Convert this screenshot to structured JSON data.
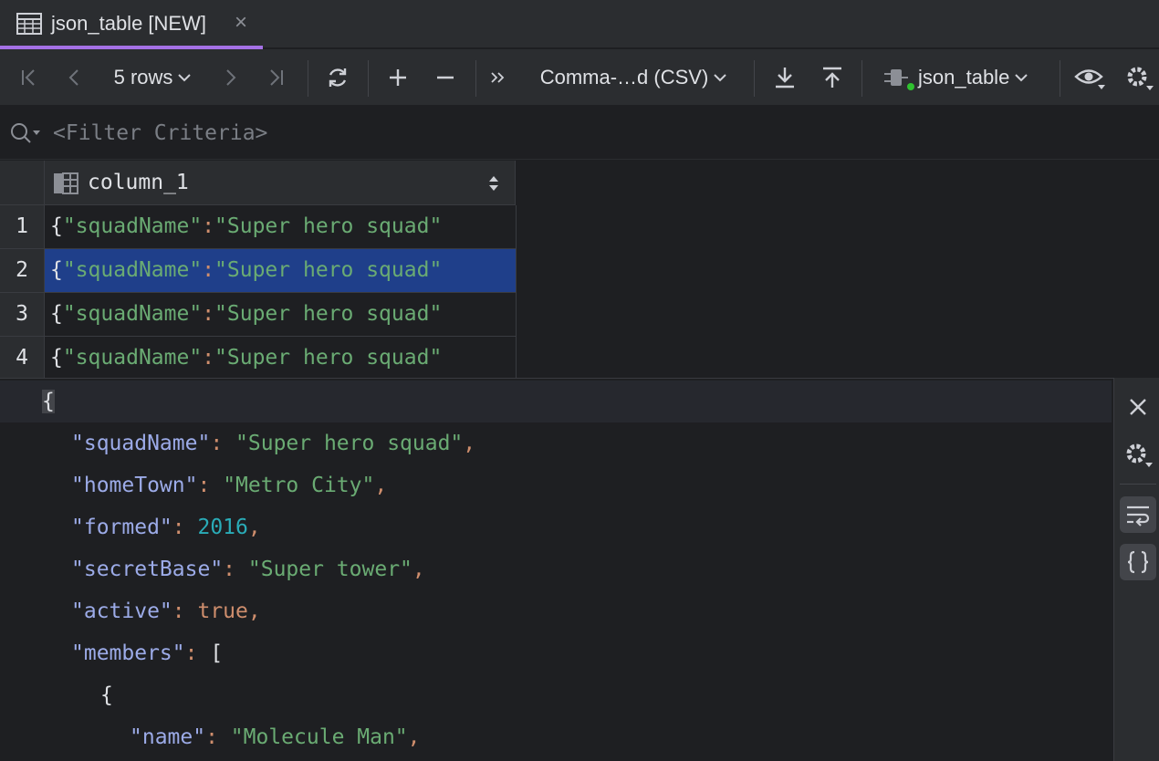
{
  "tab": {
    "title": "json_table [NEW]",
    "icon": "table-icon",
    "close": "×"
  },
  "toolbar": {
    "rows_label": "5 rows",
    "format_label": "Comma-…d (CSV)",
    "datasource_label": "json_table",
    "icons": [
      "first-page-icon",
      "prev-page-icon",
      "next-page-icon",
      "last-page-icon",
      "refresh-icon",
      "add-row-icon",
      "delete-row-icon",
      "more-icon",
      "download-icon",
      "upload-icon",
      "datasource-icon",
      "view-icon",
      "settings-icon"
    ]
  },
  "filter": {
    "placeholder": "<Filter Criteria>"
  },
  "grid": {
    "column": "column_1",
    "rows": [
      {
        "num": "1",
        "brace": "{",
        "key": "\"squadName\"",
        "colon": ":",
        "value": "\"Super hero squad\""
      },
      {
        "num": "2",
        "brace": "{",
        "key": "\"squadName\"",
        "colon": ":",
        "value": "\"Super hero squad\""
      },
      {
        "num": "3",
        "brace": "{",
        "key": "\"squadName\"",
        "colon": ":",
        "value": "\"Super hero squad\""
      },
      {
        "num": "4",
        "brace": "{",
        "key": "\"squadName\"",
        "colon": ":",
        "value": "\"Super hero squad\""
      }
    ],
    "selected_row": "2"
  },
  "editor": {
    "open_brace": "{",
    "lines": [
      {
        "key": "\"squadName\"",
        "sep": ": ",
        "value": "\"Super hero squad\"",
        "value_type": "string",
        "end": ","
      },
      {
        "key": "\"homeTown\"",
        "sep": ": ",
        "value": "\"Metro City\"",
        "value_type": "string",
        "end": ","
      },
      {
        "key": "\"formed\"",
        "sep": ": ",
        "value": "2016",
        "value_type": "number",
        "end": ","
      },
      {
        "key": "\"secretBase\"",
        "sep": ": ",
        "value": "\"Super tower\"",
        "value_type": "string",
        "end": ","
      },
      {
        "key": "\"active\"",
        "sep": ": ",
        "value": "true",
        "value_type": "boolean",
        "end": ","
      },
      {
        "key": "\"members\"",
        "sep": ": ",
        "value": "[",
        "value_type": "bracket",
        "end": ""
      }
    ],
    "member_open": "{",
    "member_line": {
      "key": "\"name\"",
      "sep": ": ",
      "value": "\"Molecule Man\"",
      "end": ","
    }
  },
  "colors": {
    "accent": "#a571e6",
    "selection": "#1f3f8a",
    "string": "#6aab73",
    "key": "#9cabe8",
    "number": "#2aacb8",
    "keyword": "#cf8e6d"
  }
}
